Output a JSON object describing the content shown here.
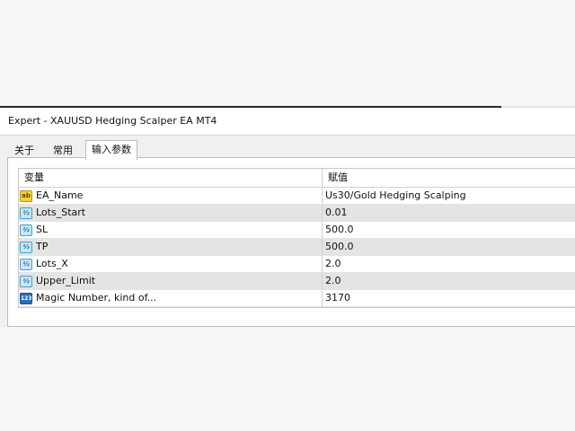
{
  "window": {
    "title": "Expert - XAUUSD Hedging Scalper EA MT4"
  },
  "tabs": [
    {
      "label": "关于"
    },
    {
      "label": "常用"
    },
    {
      "label": "输入参数"
    }
  ],
  "grid": {
    "headers": {
      "variable": "变量",
      "value": "赋值"
    },
    "rows": [
      {
        "icon": "string-ab-icon",
        "name": "EA_Name",
        "value": "Us30/Gold Hedging Scalping"
      },
      {
        "icon": "double-half-icon",
        "name": "Lots_Start",
        "value": "0.01"
      },
      {
        "icon": "double-half-icon",
        "name": "SL",
        "value": "500.0"
      },
      {
        "icon": "double-half-icon",
        "name": "TP",
        "value": "500.0"
      },
      {
        "icon": "double-half-icon",
        "name": "Lots_X",
        "value": "2.0"
      },
      {
        "icon": "double-half-icon",
        "name": "Upper_Limit",
        "value": "2.0"
      },
      {
        "icon": "integer-123-icon",
        "name": "Magic Number, kind of...",
        "value": "3170"
      }
    ]
  },
  "icon_glyphs": {
    "ab": "ab",
    "half": "½",
    "num": "123"
  },
  "colors": {
    "alt_row": "#e4e4e4",
    "background": "#f7f7f9"
  }
}
